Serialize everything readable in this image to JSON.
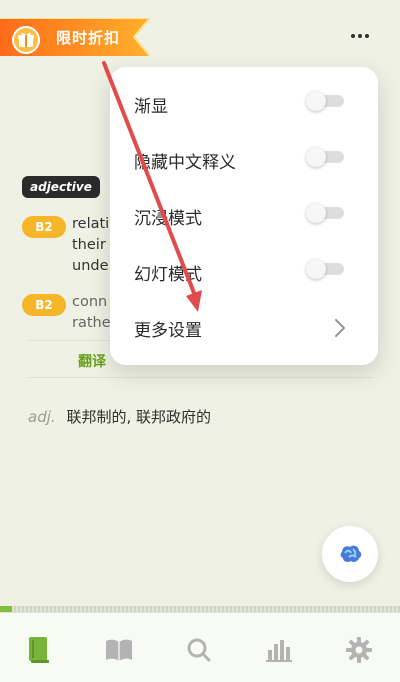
{
  "promo": {
    "label": "限时折扣",
    "icon": "gift-icon"
  },
  "header": {
    "more_icon": "more-dots-icon"
  },
  "entry": {
    "part_of_speech_badge": "adjective",
    "definitions": [
      {
        "level": "B2",
        "text": "relati\ntheir\nunde"
      },
      {
        "level": "B2",
        "text": "conn\nrathe"
      }
    ],
    "tabs": {
      "active": "翻译"
    },
    "translation": {
      "pos": "adj.",
      "text": "联邦制的, 联邦政府的"
    }
  },
  "popup_menu": {
    "items": [
      {
        "label": "渐显",
        "control": "toggle",
        "value": false
      },
      {
        "label": "隐藏中文释义",
        "control": "toggle",
        "value": false
      },
      {
        "label": "沉浸模式",
        "control": "toggle",
        "value": false
      },
      {
        "label": "幻灯模式",
        "control": "toggle",
        "value": false
      },
      {
        "label": "更多设置",
        "control": "chevron"
      }
    ]
  },
  "fab": {
    "icon": "brain-assistant-icon"
  },
  "progress": {
    "fraction": 0.03
  },
  "bottom_nav": {
    "items": [
      {
        "icon": "book-icon",
        "active": true
      },
      {
        "icon": "open-book-icon",
        "active": false
      },
      {
        "icon": "search-icon",
        "active": false
      },
      {
        "icon": "stats-icon",
        "active": false
      },
      {
        "icon": "gear-icon",
        "active": false
      }
    ]
  },
  "colors": {
    "accent": "#6aa21e",
    "promo": "#ff6a1a",
    "level_badge": "#f7b52a",
    "annotation_arrow": "#e14b4b"
  }
}
